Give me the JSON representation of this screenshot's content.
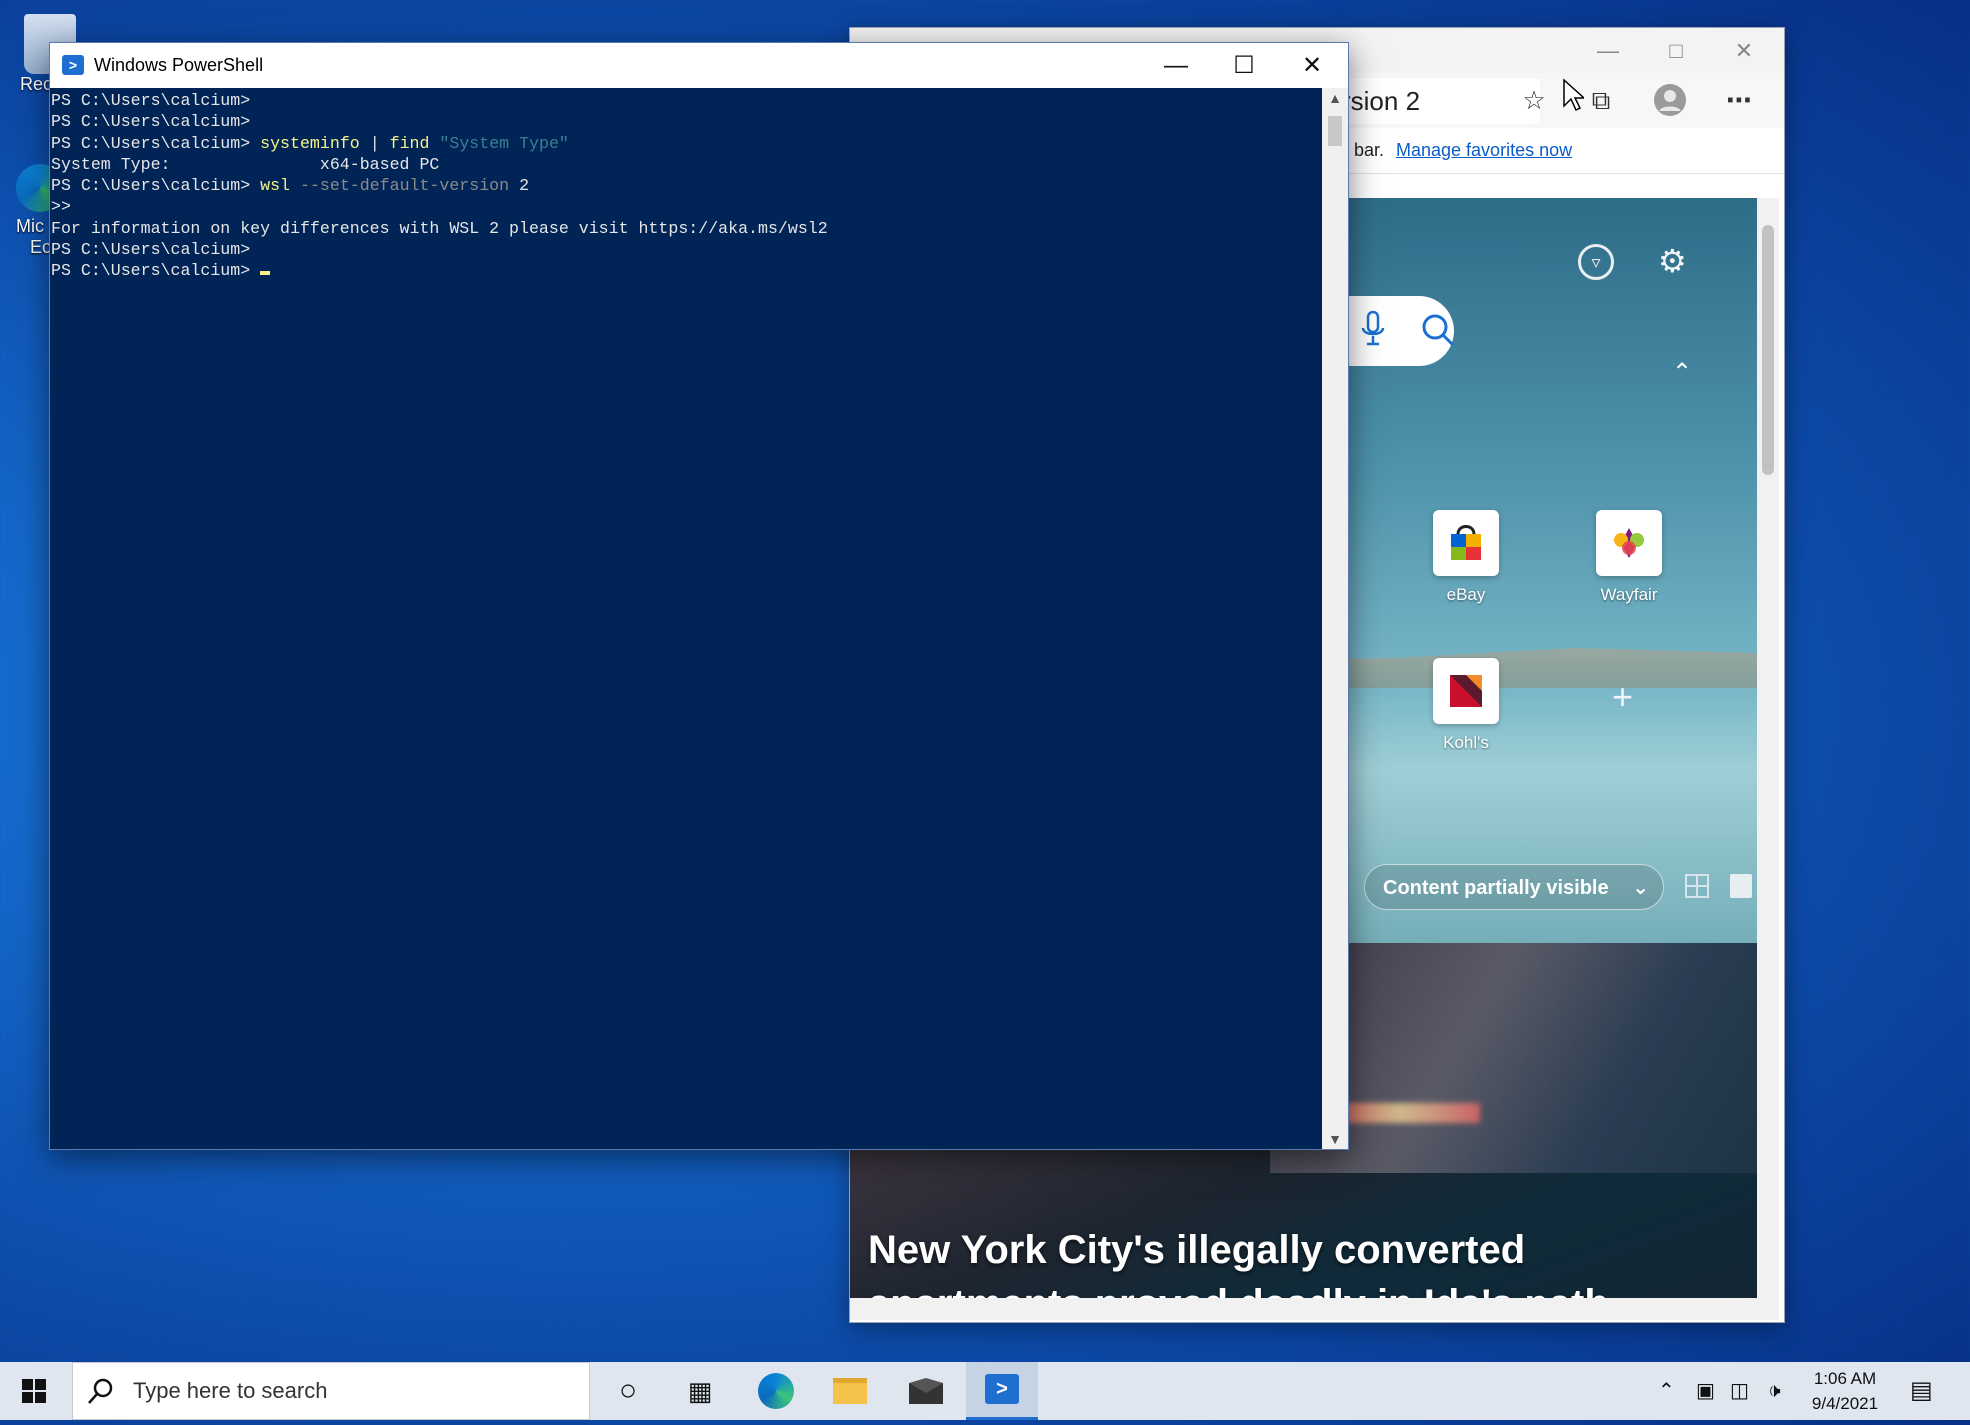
{
  "desktop": {
    "recycle_bin_label": "Recy",
    "edge_label_line1": "Mic",
    "edge_label_line2": "Ec"
  },
  "edge": {
    "address_fragment": "rsion 2",
    "favbar_prefix": "bar.",
    "manage_favorites": "Manage favorites now",
    "tiles": [
      {
        "label": "eBay"
      },
      {
        "label": "Wayfair"
      },
      {
        "label": "Kohl's"
      }
    ],
    "add_tile": "+",
    "content_visibility": "Content partially visible",
    "news_headline": "New York City's illegally converted apartments proved deadly in Ida's path",
    "link_color": "#0a5cc8"
  },
  "powershell": {
    "title": "Windows PowerShell",
    "prompt": "PS C:\\Users\\calcium>",
    "lines": {
      "l1": "PS C:\\Users\\calcium>",
      "l2": "PS C:\\Users\\calcium>",
      "l3_cmd": "systeminfo",
      "l3_pipe": " | ",
      "l3_find": "find",
      "l3_str": "\"System Type\"",
      "l4": "System Type:               x64-based PC",
      "l5_cmd": "wsl",
      "l5_param": "--set-default-version",
      "l5_val": "2",
      "l6": ">>",
      "l7": "For information on key differences with WSL 2 please visit https://aka.ms/wsl2",
      "l8": "PS C:\\Users\\calcium>",
      "l9": "PS C:\\Users\\calcium>"
    },
    "background": "#012456",
    "command_color": "#f6f28a"
  },
  "taskbar": {
    "search_placeholder": "Type here to search",
    "time": "1:06 AM",
    "date": "9/4/2021"
  }
}
